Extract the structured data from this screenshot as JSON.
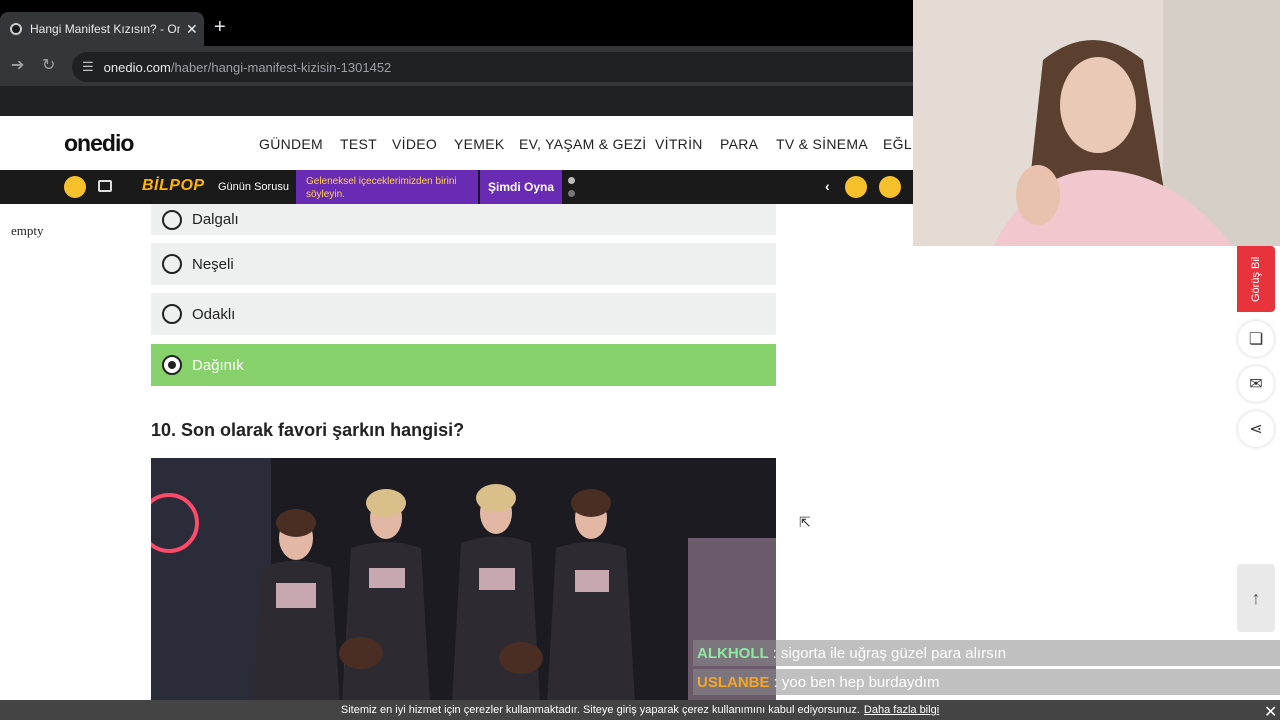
{
  "browser": {
    "tab_title": "Hangi Manifest Kızısın? - Onedio",
    "new_tab": "+",
    "tab_close": "✕",
    "url_domain": "onedio.com",
    "url_path": "/haber/hangi-manifest-kizisin-1301452"
  },
  "site": {
    "logo": "onedio",
    "nav": [
      "GÜNDEM",
      "TEST",
      "VİDEO",
      "YEMEK",
      "EV, YAŞAM & GEZİ",
      "VİTRİN",
      "PARA",
      "TV & SİNEMA",
      "EĞLE"
    ]
  },
  "bilpop": {
    "brand": "BİLPOP",
    "daily_label": "Günün Sorusu",
    "question": "Geleneksel içeceklerimizden birini söyleyin.",
    "play_button": "Şimdi Oyna"
  },
  "content": {
    "empty_text": "empty",
    "options": [
      {
        "label": "Dalgalı",
        "selected": false
      },
      {
        "label": "Neşeli",
        "selected": false
      },
      {
        "label": "Odaklı",
        "selected": false
      },
      {
        "label": "Dağınık",
        "selected": true
      }
    ],
    "question_10": "10. Son olarak favori şarkın hangisi?"
  },
  "sidebar": {
    "feedback_tab": "Görüş Bil"
  },
  "chat": [
    {
      "user": "ALKHOLL",
      "message": ": sigorta ile uğraş güzel para alırsın"
    },
    {
      "user": "USLANBE",
      "message": ": yoo ben hep burdaydım"
    }
  ],
  "cookie": {
    "text": "Sitemiz en iyi hizmet için çerezler kullanmaktadır. Siteye giriş yaparak çerez kullanımını kabul ediyorsunuz.",
    "link": "Daha fazla bilgi",
    "close": "✕"
  },
  "colors": {
    "selected_option": "#87d16b",
    "option_bg": "#edf0ee",
    "bilpop_purple": "#6a2bb4",
    "feedback_red": "#e8323c"
  }
}
